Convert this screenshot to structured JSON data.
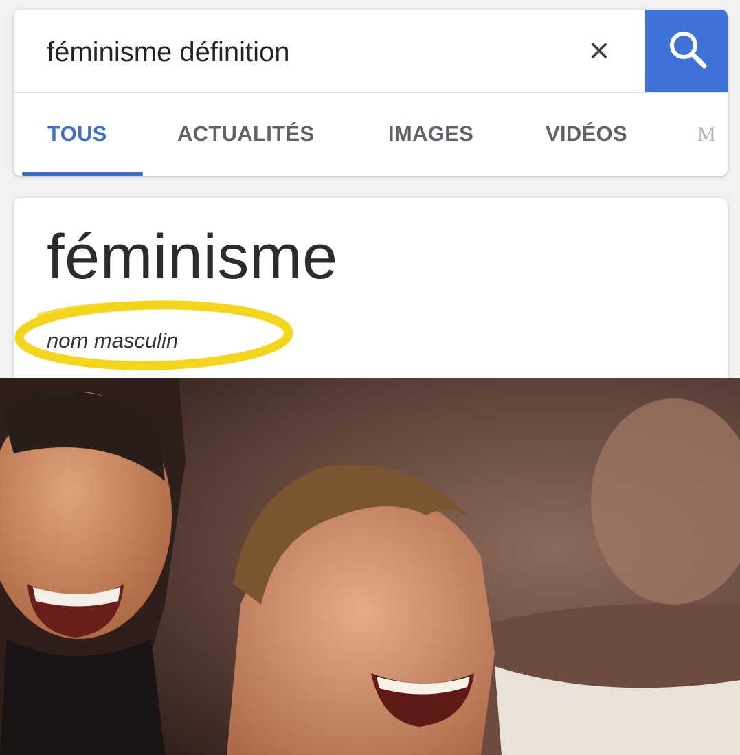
{
  "search": {
    "query": "féminisme définition",
    "clear_icon": "close-icon",
    "search_icon": "search-icon",
    "accent_color": "#3f73d8"
  },
  "tabs": [
    {
      "label": "TOUS",
      "active": true
    },
    {
      "label": "ACTUALITÉS",
      "active": false
    },
    {
      "label": "IMAGES",
      "active": false
    },
    {
      "label": "VIDÉOS",
      "active": false
    },
    {
      "label": "M",
      "active": false
    }
  ],
  "definition": {
    "word": "féminisme",
    "part_of_speech": "nom masculin",
    "highlight_color": "#f2d51c"
  },
  "meme_image": {
    "content": "two laughing faces"
  }
}
